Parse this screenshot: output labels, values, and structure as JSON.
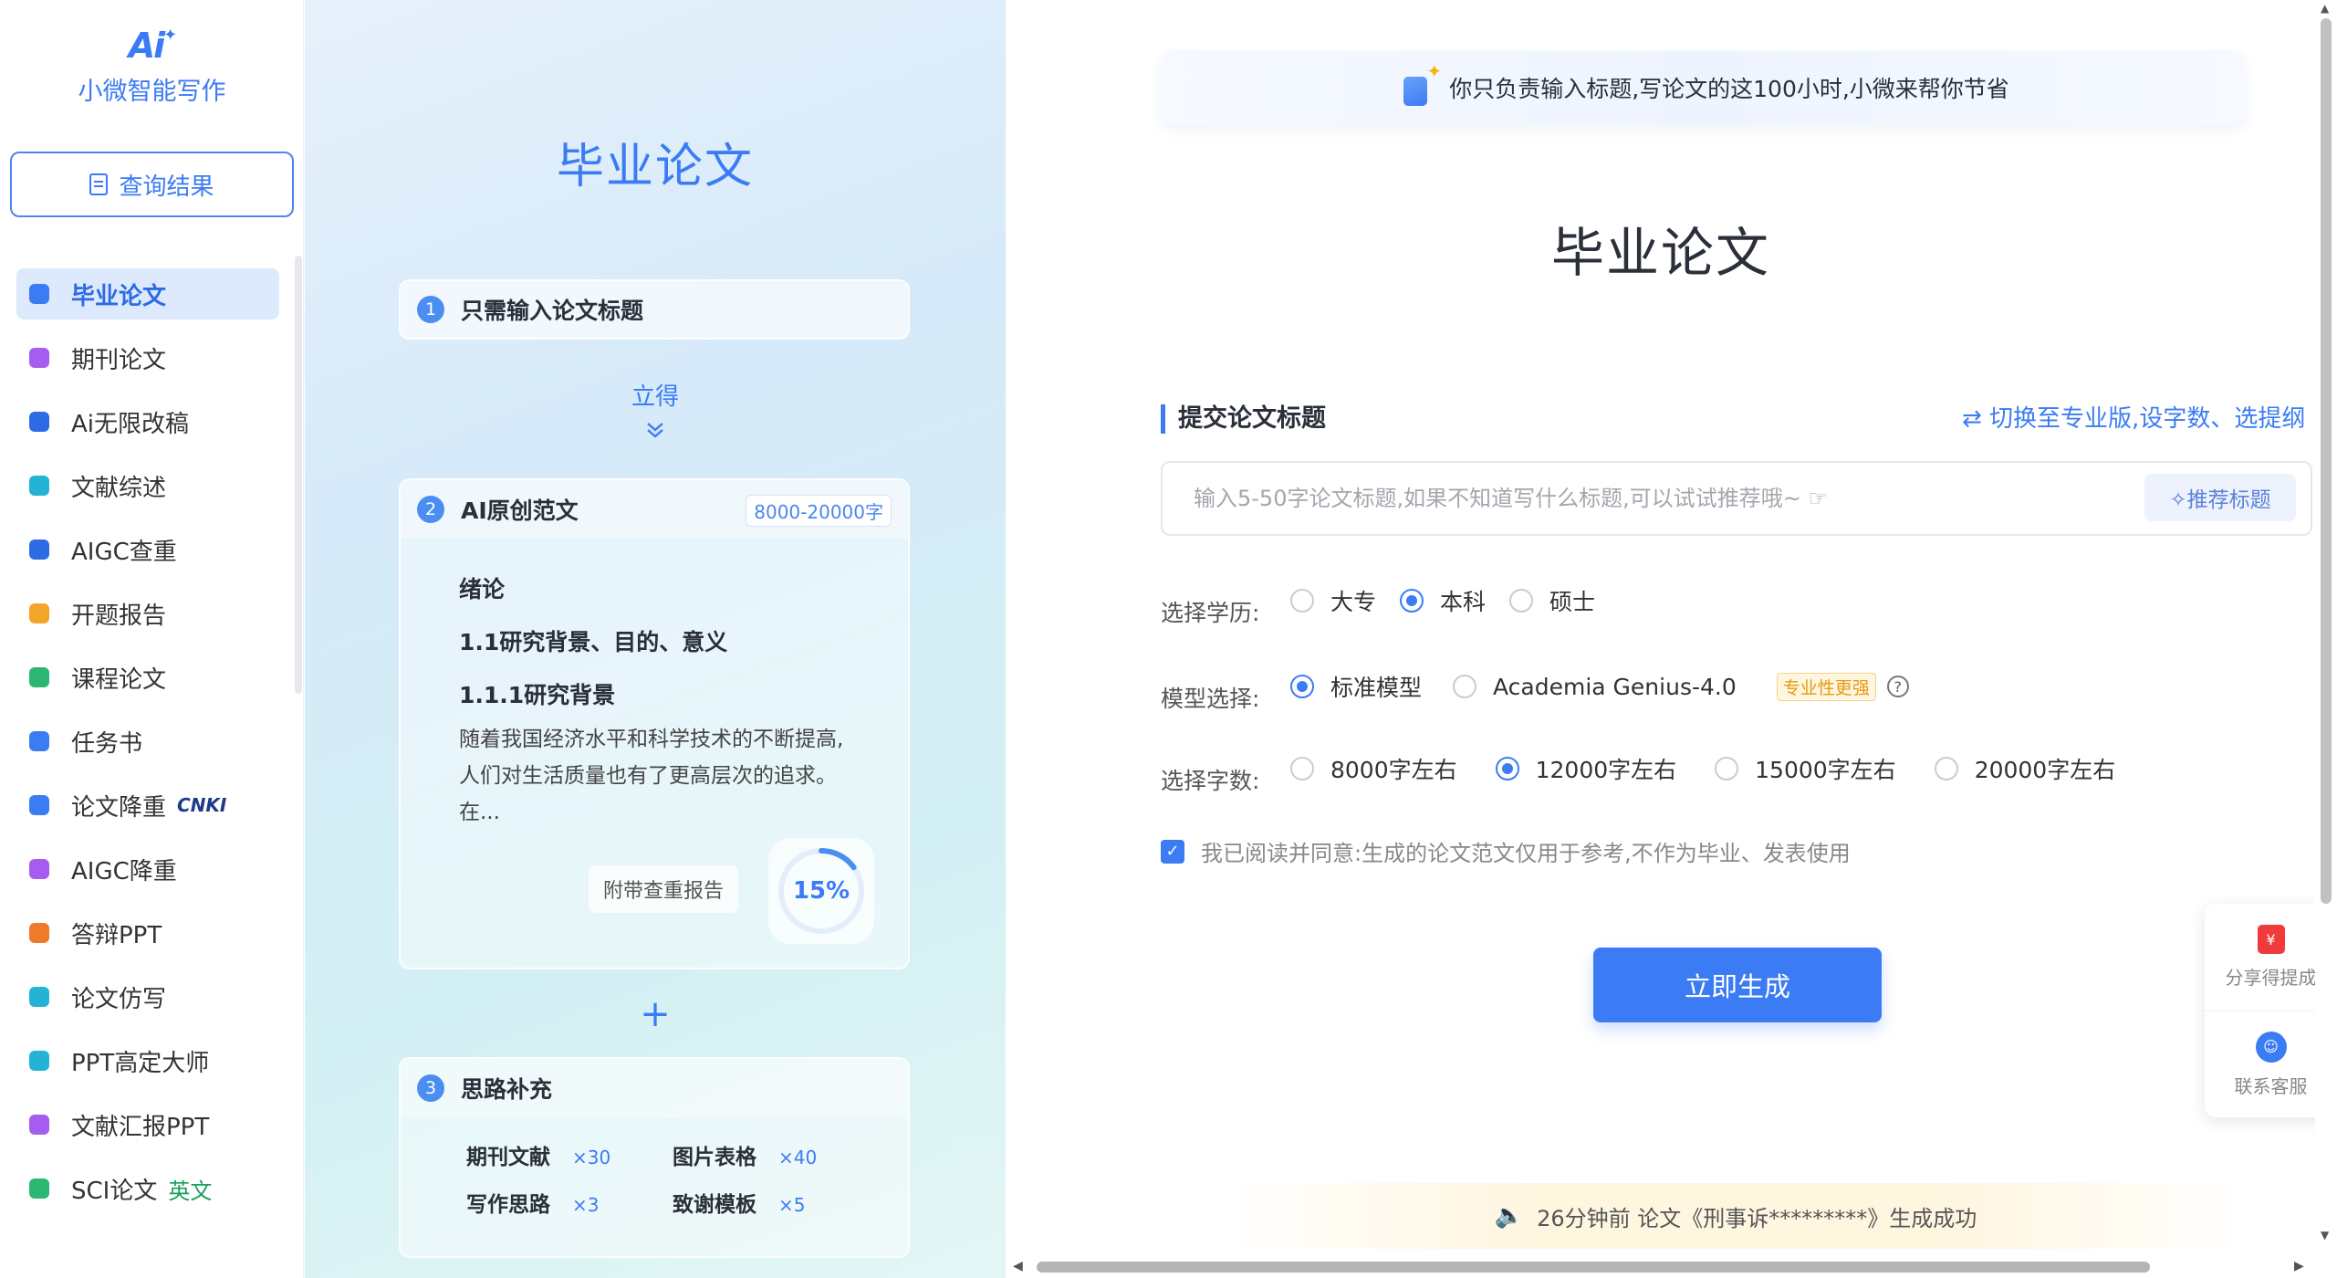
{
  "sidebar": {
    "logo_mark": "Ai",
    "app_name": "小微智能写作",
    "query_button": "查询结果",
    "items": [
      {
        "label": "毕业论文",
        "icon": "graduation-cap-icon",
        "color": "#3b7cf4",
        "active": true
      },
      {
        "label": "期刊论文",
        "icon": "journal-icon",
        "color": "#a65cf0"
      },
      {
        "label": "Ai无限改稿",
        "icon": "pen-icon",
        "color": "#2d6be4"
      },
      {
        "label": "文献综述",
        "icon": "bars-icon",
        "color": "#22b3d6"
      },
      {
        "label": "AIGC查重",
        "icon": "search-icon",
        "color": "#2d6be4"
      },
      {
        "label": "开题报告",
        "icon": "report-icon",
        "color": "#f3a52a"
      },
      {
        "label": "课程论文",
        "icon": "book-icon",
        "color": "#2bb673"
      },
      {
        "label": "任务书",
        "icon": "task-icon",
        "color": "#3b7cf4"
      },
      {
        "label": "论文降重",
        "icon": "reduce-icon",
        "color": "#3b7cf4",
        "extra": "CNKI"
      },
      {
        "label": "AIGC降重",
        "icon": "ai-icon",
        "color": "#a65cf0"
      },
      {
        "label": "答辩PPT",
        "icon": "ppt-icon",
        "color": "#f07a2a"
      },
      {
        "label": "论文仿写",
        "icon": "copy-icon",
        "color": "#22b3d6"
      },
      {
        "label": "PPT高定大师",
        "icon": "ppt-master-icon",
        "color": "#22b3d6"
      },
      {
        "label": "文献汇报PPT",
        "icon": "ppt-report-icon",
        "color": "#a65cf0"
      },
      {
        "label": "SCI论文",
        "icon": "sci-icon",
        "color": "#2bb673",
        "extra": "英文"
      }
    ]
  },
  "middle": {
    "title": "毕业论文",
    "step1": {
      "num": "1",
      "title": "只需输入论文标题"
    },
    "arrow_text": "立得",
    "step2": {
      "num": "2",
      "title": "AI原创范文",
      "badge": "8000-20000字",
      "heading1": "绪论",
      "heading2": "1.1研究背景、目的、意义",
      "heading3": "1.1.1研究背景",
      "para1": "随着我国经济水平和科学技术的不断提高,",
      "para2": "人们对生活质量也有了更高层次的追求。",
      "para3": "在...",
      "report_tag": "附带查重报告",
      "ring_value": "15%",
      "ring_fraction": 0.15
    },
    "plus": "+",
    "step3": {
      "num": "3",
      "title": "思路补充",
      "chips": [
        {
          "label": "期刊文献",
          "count": "×30"
        },
        {
          "label": "图片表格",
          "count": "×40"
        },
        {
          "label": "写作思路",
          "count": "×3"
        },
        {
          "label": "致谢模板",
          "count": "×5"
        }
      ]
    }
  },
  "main": {
    "banner_text": "你只负责输入标题,写论文的这100小时,小微来帮你节省",
    "title": "毕业论文",
    "section_label": "提交论文标题",
    "switch_link": "⇄ 切换至专业版,设字数、选提纲",
    "input_placeholder": "输入5-50字论文标题,如果不知道写什么标题,可以试试推荐哦~ ☞",
    "recommend_button": "✧推荐标题",
    "education": {
      "label": "选择学历:",
      "options": [
        "大专",
        "本科",
        "硕士"
      ],
      "selected": "本科"
    },
    "model": {
      "label": "模型选择:",
      "options": [
        "标准模型",
        "Academia Genius-4.0"
      ],
      "selected": "标准模型",
      "pro_tag": "专业性更强",
      "help": "?"
    },
    "words": {
      "label": "选择字数:",
      "options": [
        "8000字左右",
        "12000字左右",
        "15000字左右",
        "20000字左右"
      ],
      "selected": "12000字左右"
    },
    "agree_text": "我已阅读并同意:生成的论文范文仅用于参考,不作为毕业、发表使用",
    "generate_button": "立即生成",
    "notice": "26分钟前 论文《刑事诉*********》生成成功",
    "float": {
      "share": "分享得提成",
      "service": "联系客服"
    }
  }
}
